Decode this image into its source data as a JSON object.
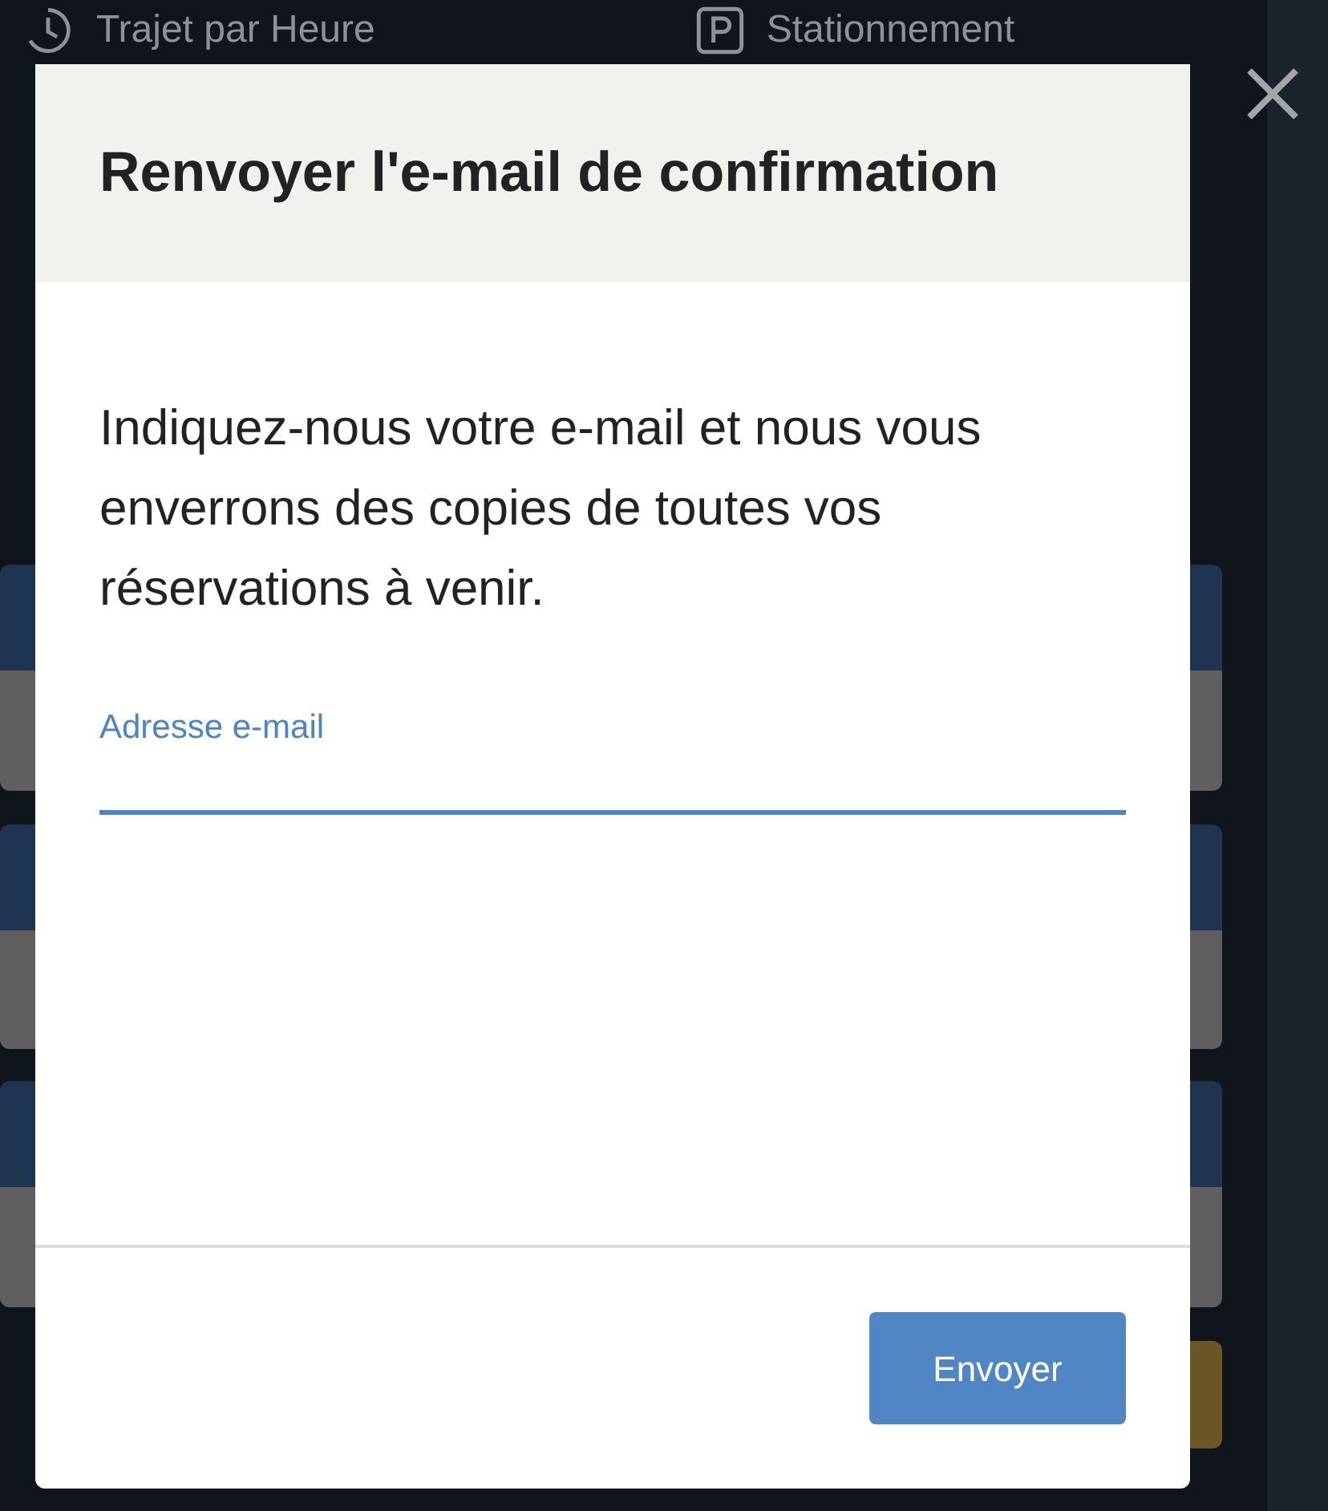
{
  "background": {
    "nav": [
      {
        "label": "Trajet par Heure",
        "kind": "clock"
      },
      {
        "label": "Stationnement",
        "kind": "parking"
      }
    ]
  },
  "dialog": {
    "title": "Renvoyer l'e-mail de confirmation",
    "message": "Indiquez-nous votre e-mail et nous vous enverrons des copies de toutes vos réservations à venir.",
    "email_field": {
      "label": "Adresse e-mail",
      "focused": true
    },
    "submit_button": "Envoyer"
  }
}
